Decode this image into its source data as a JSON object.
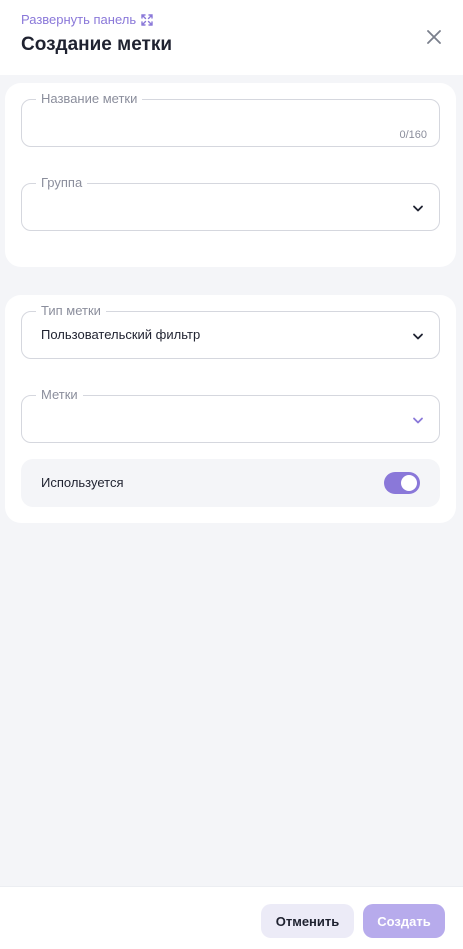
{
  "header": {
    "expand_label": "Развернуть панель",
    "title": "Создание метки"
  },
  "section1": {
    "name_field": {
      "label": "Название метки",
      "value": "",
      "counter": "0/160"
    },
    "group_field": {
      "label": "Группа",
      "value": ""
    }
  },
  "section2": {
    "type_field": {
      "label": "Тип метки",
      "value": "Пользовательский фильтр"
    },
    "tags_field": {
      "label": "Метки",
      "value": ""
    },
    "used_toggle": {
      "label": "Используется",
      "checked": true
    }
  },
  "footer": {
    "cancel_label": "Отменить",
    "create_label": "Создать"
  },
  "colors": {
    "accent": "#8a78d9",
    "accent_disabled": "#b7abec",
    "background": "#f4f5f8",
    "card": "#ffffff"
  },
  "icons": {
    "expand": "expand-arrows-icon",
    "close": "close-icon",
    "chevron": "chevron-down-icon"
  }
}
